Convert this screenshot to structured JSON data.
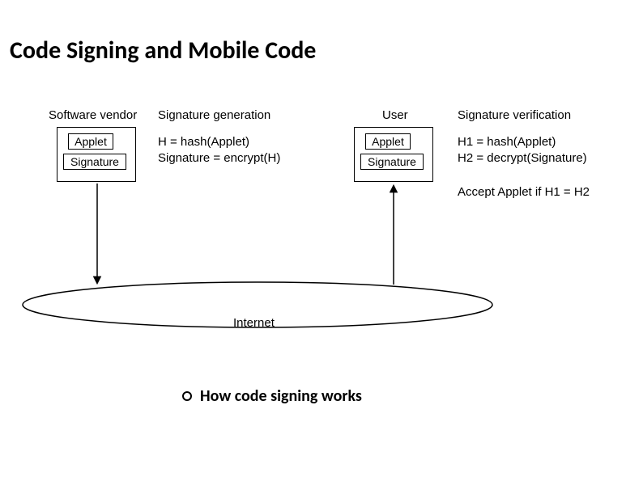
{
  "title": "Code Signing and Mobile Code",
  "vendor": {
    "label": "Software vendor",
    "applet": "Applet",
    "signature": "Signature"
  },
  "siggen": {
    "label": "Signature generation",
    "line1": "H = hash(Applet)",
    "line2": "Signature = encrypt(H)"
  },
  "user": {
    "label": "User",
    "applet": "Applet",
    "signature": "Signature"
  },
  "sigver": {
    "label": "Signature verification",
    "line1": "H1 = hash(Applet)",
    "line2": "H2 = decrypt(Signature)",
    "accept": "Accept Applet if H1 = H2"
  },
  "internet": "Internet",
  "caption": "How code signing works"
}
